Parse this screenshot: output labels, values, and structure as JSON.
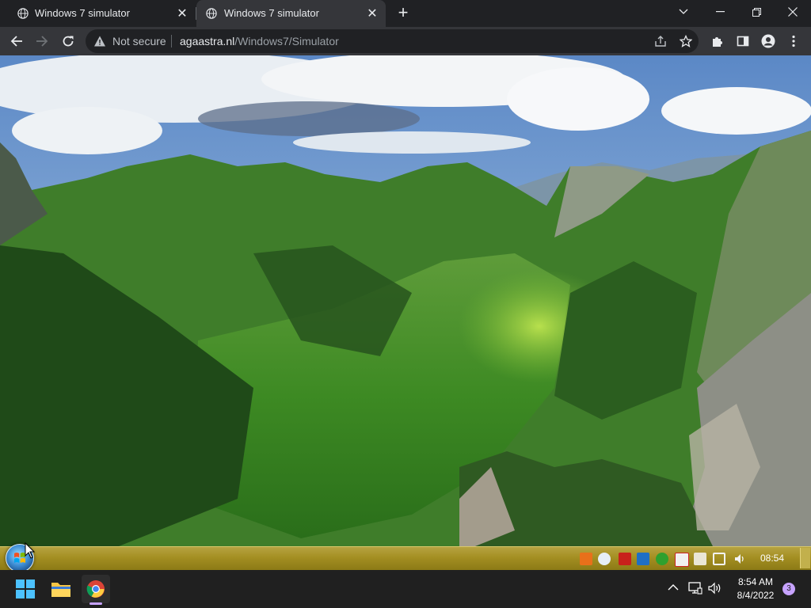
{
  "browser": {
    "tabs": [
      {
        "title": "Windows 7 simulator",
        "active": false
      },
      {
        "title": "Windows 7 simulator",
        "active": true
      }
    ],
    "security_label": "Not secure",
    "url_host": "agaastra.nl",
    "url_path": "/Windows7/Simulator",
    "theme": {
      "frame": "#202124",
      "toolbar": "#35363a",
      "text": "#e8eaed"
    }
  },
  "simulator": {
    "wallpaper": "mountain-valley-landscape",
    "taskbar_color": "#a89424",
    "clock": "08:54",
    "tray_icons": [
      "app-orange-icon",
      "network-globe-icon",
      "adobe-red-icon",
      "outlook-icon",
      "security-check-icon",
      "flag-red-icon",
      "clipboard-icon",
      "network-icon",
      "volume-icon"
    ]
  },
  "os_taskbar": {
    "apps": [
      "windows-start-icon",
      "file-explorer-icon",
      "chrome-icon"
    ],
    "time": "8:54 AM",
    "date": "8/4/2022",
    "notifications": "3",
    "accent": "#c7a3ff"
  }
}
